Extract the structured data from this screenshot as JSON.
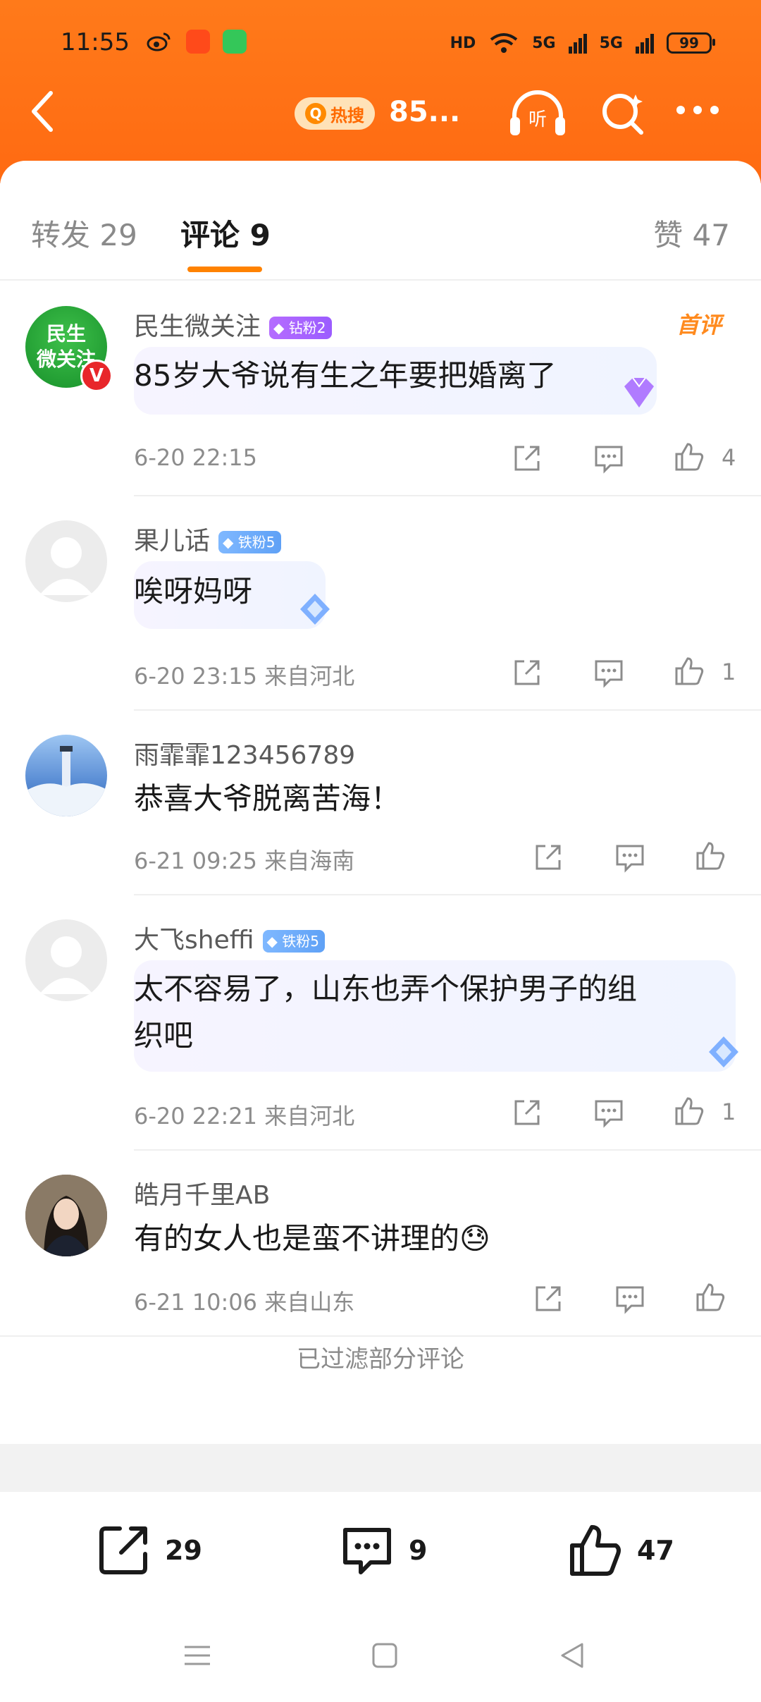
{
  "status": {
    "time": "11:55",
    "battery": "99",
    "network": [
      "HD",
      "5G",
      "5G"
    ]
  },
  "header": {
    "hot_label": "热搜",
    "hot_icon_glyph": "Q",
    "title": "85..."
  },
  "tabs": {
    "reposts": "转发 29",
    "comments": "评论 9",
    "likes": "赞 47"
  },
  "comments": [
    {
      "name": "民生微关注",
      "badge": "钻粉2",
      "first_comment": "首评",
      "text": "85岁大爷说有生之年要把婚离了",
      "time": "6-20 22:15",
      "likes": "4",
      "avatar_text": "民生\n微关注"
    },
    {
      "name": "果儿话",
      "badge": "铁粉5",
      "text": "唉呀妈呀",
      "time": "6-20 23:15 来自河北",
      "likes": "1"
    },
    {
      "name": "雨霏霏123456789",
      "text": "恭喜大爷脱离苦海！",
      "time": "6-21 09:25 来自海南",
      "likes": ""
    },
    {
      "name": "大飞sheffi",
      "badge": "铁粉5",
      "text_line1": "太不容易了，山东也弄个保护男子的组",
      "text_line2": "织吧",
      "time": "6-20 22:21 来自河北",
      "likes": "1"
    },
    {
      "name": "皓月千里AB",
      "text": "有的女人也是蛮不讲理的😓",
      "time": "6-21 10:06 来自山东",
      "likes": ""
    }
  ],
  "filtered_note": "已过滤部分评论",
  "bottom_bar": {
    "reposts": "29",
    "comments": "9",
    "likes": "47"
  },
  "colors": {
    "header": "#ff6a12",
    "accent": "#ff8200",
    "diamond_badge": "#9b5cff",
    "iron_badge": "#5fa1f6"
  }
}
